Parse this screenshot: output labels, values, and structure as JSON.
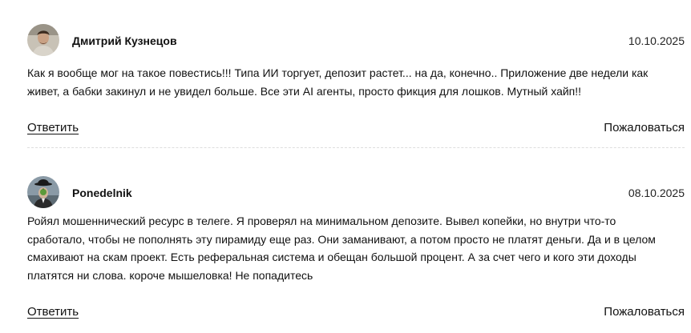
{
  "comments": [
    {
      "author": "Дмитрий Кузнецов",
      "date": "10.10.2025",
      "text": "Как я вообще мог на такое повестись!!! Типа ИИ торгует, депозит растет... на да, конечно.. Приложение две недели как живет, а бабки закинул и не увидел больше. Все эти AI агенты, просто фикция для лошков. Мутный хайп!!",
      "reply_label": "Ответить",
      "report_label": "Пожаловаться"
    },
    {
      "author": "Ponedelnik",
      "date": "08.10.2025",
      "text": "Ройял мошеннический ресурс в телеге. Я проверял на минимальном депозите. Вывел копейки, но внутри что-то сработало, чтобы не пополнять эту пирамиду еще раз. Они заманивают, а потом просто не платят деньги. Да и в целом смахивают на скам проект. Есть реферальная система и обещан большой процент. А за счет чего и кого эти доходы платятся ни слова. короче мышеловка! Не попадитесь",
      "reply_label": "Ответить",
      "report_label": "Пожаловаться"
    }
  ]
}
